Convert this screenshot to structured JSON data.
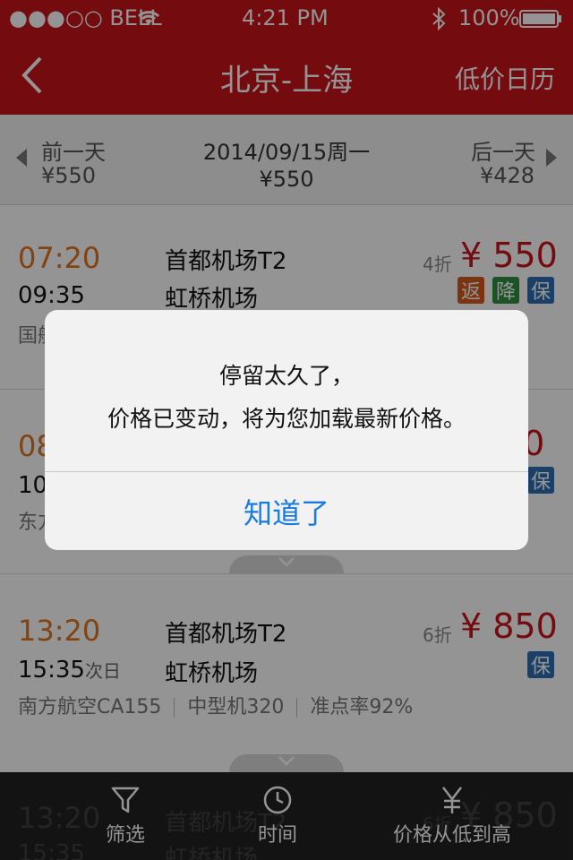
{
  "status": {
    "carrier": "●●●○○ BELL",
    "time": "4:21 PM",
    "battery": "100%"
  },
  "nav": {
    "title": "北京-上海",
    "right": "低价日历"
  },
  "datebar": {
    "prev_label": "前一天",
    "prev_price": "¥550",
    "current_date": "2014/09/15周一",
    "current_price": "¥550",
    "next_label": "后一天",
    "next_price": "¥428"
  },
  "flights": [
    {
      "dep": "07:20",
      "arr": "09:35",
      "arr_suffix": "",
      "from": "首都机场T2",
      "to": "虹桥机场",
      "discount": "4折",
      "price": "¥ 550",
      "tags": [
        "返",
        "降",
        "保"
      ],
      "info": [
        "国航"
      ]
    },
    {
      "dep": "08",
      "arr": "10",
      "arr_suffix": "",
      "from": "",
      "to": "",
      "discount": "",
      "price": "30",
      "tags": [
        "保"
      ],
      "info": [
        "东方"
      ]
    },
    {
      "dep": "13:20",
      "arr": "15:35",
      "arr_suffix": "次日",
      "from": "首都机场T2",
      "to": "虹桥机场",
      "discount": "6折",
      "price": "¥ 850",
      "tags": [
        "保"
      ],
      "info": [
        "南方航空CA155",
        "中型机320",
        "准点率92%"
      ]
    },
    {
      "dep": "13:20",
      "arr": "15:35",
      "from": "首都机场T2",
      "to": "虹桥机场",
      "discount": "6折",
      "price": "¥ 850"
    }
  ],
  "tag_colors": {
    "返": "#d4581c",
    "降": "#2f8f3e",
    "保": "#2f6fb4"
  },
  "tabbar": {
    "filter": {
      "label": "筛选",
      "icon": "filter-icon"
    },
    "time": {
      "label": "时间",
      "icon": "clock-icon"
    },
    "price": {
      "label": "价格从低到高",
      "icon": "yen-icon"
    }
  },
  "alert": {
    "line1": "停留太久了，",
    "line2": "价格已变动，将为您加载最新价格。",
    "button": "知道了"
  }
}
